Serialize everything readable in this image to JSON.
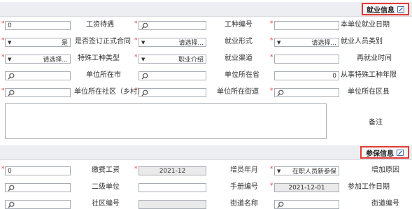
{
  "employment_section": {
    "title": "就业信息",
    "labels": {
      "employment_date": "本单位就业日期",
      "job_no": "工种编号",
      "salary": "工资待遇",
      "person_category": "就业人员类别",
      "employment_form": "就业形式",
      "signed_contract": "是否签订正式合同",
      "reemployment_time": "再就业时间",
      "channel": "就业渠道",
      "special_job_type": "特殊工种类型",
      "special_job_years": "从事特殊工种年限",
      "unit_province": "单位所在省",
      "unit_city": "单位所在市",
      "unit_county": "单位所在区县",
      "unit_street": "单位所在街道",
      "unit_community": "单位所在社区（乡村）",
      "remark": "备注"
    },
    "values": {
      "salary": "0",
      "person_category": "请选择...",
      "employment_form": "请选择...",
      "signed_contract": "是",
      "channel": "职业介绍",
      "special_job_type": "请选择...",
      "special_job_years": "0"
    }
  },
  "insurance_section": {
    "title": "参保信息",
    "labels": {
      "reason": "增加原因",
      "month": "增员年月",
      "base_salary": "缴费工资",
      "work_date": "参加工作日期",
      "manual_no": "手册编号",
      "second_unit": "二级单位",
      "street_no": "街道编号",
      "street_name": "街道名称",
      "community_no": "社区编号"
    },
    "values": {
      "reason": "在职人员新参保",
      "month": "2021-12",
      "base_salary": "0",
      "work_date": "2021-12-01"
    }
  },
  "colors": {
    "accent_border": "#e53935",
    "header_bg": "#eceef2",
    "required_star": "#e53935"
  },
  "icons": [
    "edit-icon",
    "search-icon",
    "chevron-down-icon"
  ]
}
